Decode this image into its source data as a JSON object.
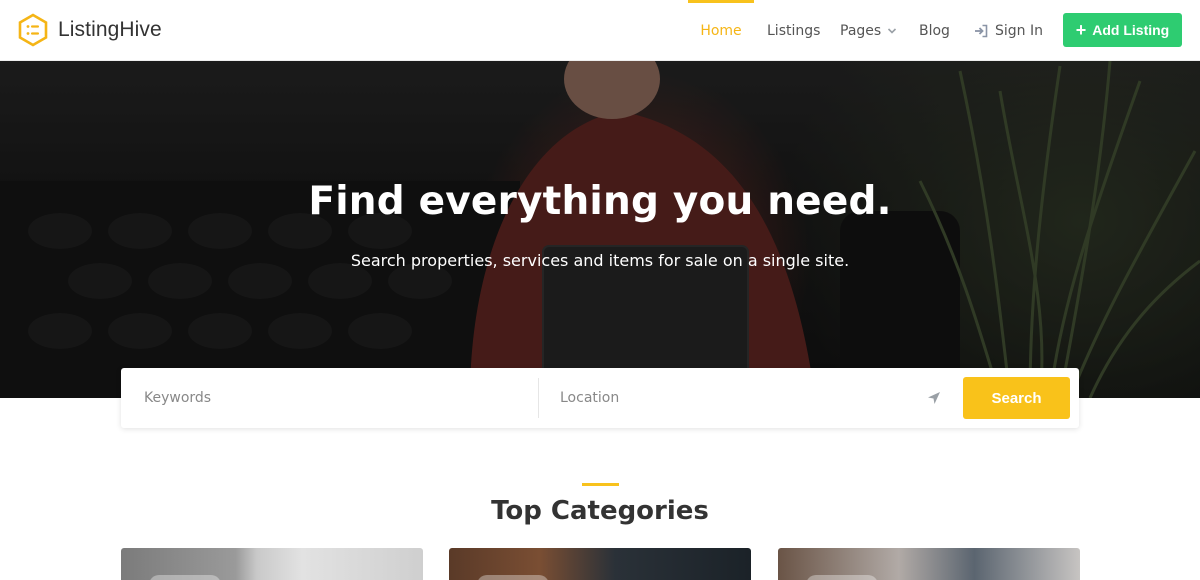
{
  "brand": {
    "name": "ListingHive",
    "accent": "#f8c21d",
    "green": "#2ecc71"
  },
  "nav": {
    "home": "Home",
    "listings": "Listings",
    "pages": "Pages",
    "blog": "Blog",
    "sign_in": "Sign In",
    "add_listing": "Add Listing"
  },
  "hero": {
    "title": "Find everything you need.",
    "subtitle": "Search properties, services and items for sale on a single site."
  },
  "search": {
    "keywords_placeholder": "Keywords",
    "location_placeholder": "Location",
    "button": "Search"
  },
  "categories": {
    "title": "Top Categories"
  },
  "icons": {
    "logo": "hexagon-list-icon",
    "pages_dropdown": "chevron-down-icon",
    "sign_in": "sign-in-icon",
    "add": "plus-icon",
    "location": "location-arrow-icon"
  }
}
